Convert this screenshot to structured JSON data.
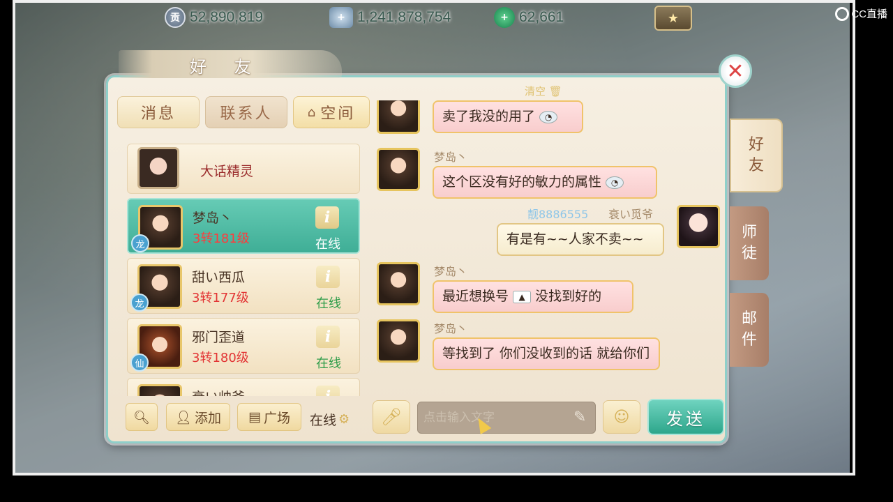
{
  "currencies": [
    {
      "icon": "silver-coin-icon",
      "value": "52,890,819"
    },
    {
      "icon": "silver-ingot-icon",
      "value": "1,241,878,754"
    },
    {
      "icon": "jade-coin-icon",
      "value": "62,661"
    }
  ],
  "watermark": "CC直播",
  "panel": {
    "title": "好 友",
    "tabs": {
      "messages": "消息",
      "contacts": "联系人",
      "space": "空间"
    }
  },
  "friends": [
    {
      "name": "大话精灵",
      "level": "",
      "status": ""
    },
    {
      "name": "梦岛丶",
      "level": "3转181级",
      "status": "在线",
      "tag": "龙"
    },
    {
      "name": "甜い西瓜",
      "level": "3转177级",
      "status": "在线",
      "tag": "龙"
    },
    {
      "name": "邪门歪道",
      "level": "3转180级",
      "status": "在线",
      "tag": "仙"
    },
    {
      "name": "衰い帅爷",
      "level": "",
      "status": ""
    }
  ],
  "bottom_left": {
    "add": "添加",
    "plaza": "广场",
    "online": "在线"
  },
  "chat": {
    "clear": "清空",
    "messages": [
      {
        "sender": "",
        "text": "卖了我没的用了"
      },
      {
        "sender": "梦岛丶",
        "text": "这个区没有好的敏力的属性"
      },
      {
        "sender_id": "靓8886555",
        "sender": "衰い觅爷",
        "text": "有是有~~人家不卖~~"
      },
      {
        "sender": "梦岛丶",
        "text_before": "最近想换号",
        "text_after": "没找到好的"
      },
      {
        "sender": "梦岛丶",
        "text": "等找到了 你们没收到的话 就给你们"
      }
    ],
    "input_placeholder": "点击输入文字",
    "send": "发送"
  },
  "side_tabs": {
    "friends": "好友",
    "master": "师徒",
    "mail": "邮件"
  },
  "icons": {
    "close": "close-icon",
    "search": "search-icon",
    "add": "add-user-icon",
    "plaza": "plaza-icon",
    "mic": "microphone-icon",
    "emoji": "emoji-icon",
    "pen": "pen-icon",
    "home": "home-icon"
  }
}
